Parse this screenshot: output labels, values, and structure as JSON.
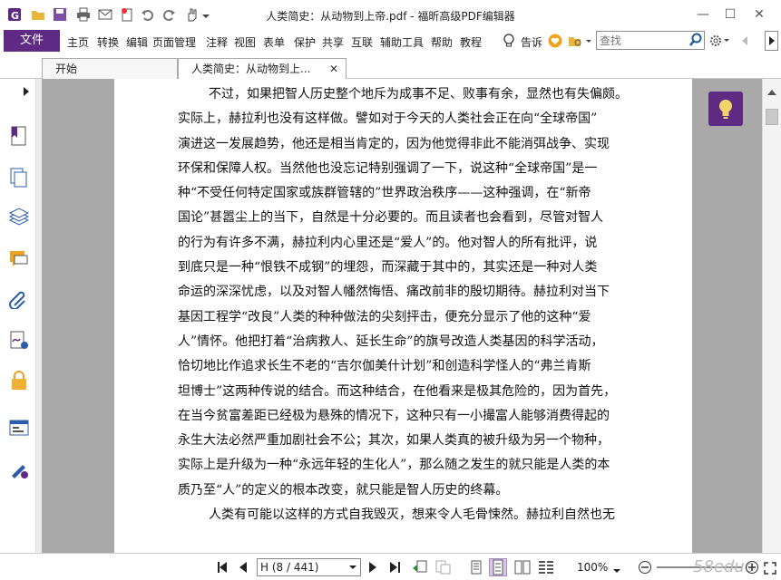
{
  "window": {
    "title": "人类简史：从动物到上帝.pdf - 福昕高级PDF编辑器",
    "minimize_glyph": "—",
    "maximize_glyph": "☐",
    "close_glyph": "✕"
  },
  "quick_access": [
    "app-logo-icon",
    "open-folder-icon",
    "save-icon",
    "print-icon",
    "email-icon",
    "new-icon",
    "undo-icon",
    "redo-icon",
    "hand-tool-icon"
  ],
  "menu": {
    "file_label": "文件",
    "items": [
      "主页",
      "转换",
      "编辑",
      "页面管理",
      "注释",
      "视图",
      "表单",
      "保护",
      "共享",
      "互联",
      "辅助工具",
      "帮助",
      "教程"
    ],
    "tell_me_label": "告诉",
    "search_placeholder": "查找"
  },
  "tabs": [
    {
      "label": "开始",
      "active": false
    },
    {
      "label": "人类简史：从动物到上...",
      "active": true
    }
  ],
  "sidebar_icons": [
    "bookmark-icon",
    "pages-icon",
    "layers-icon",
    "comments-icon",
    "attachments-icon",
    "signature-icon",
    "security-icon",
    "form-fields-icon",
    "certify-icon"
  ],
  "document": {
    "lines": [
      {
        "text": "不过，如果把智人历史整个地斥为成事不足、败事有余，显然也有失偏颇。",
        "indent": true
      },
      {
        "text": "实际上，赫拉利也没有这样做。譬如对于今天的人类社会正在向“全球帝国”",
        "indent": false
      },
      {
        "text": "演进这一发展趋势，他还是相当肯定的，因为他觉得非此不能消弭战争、实现",
        "indent": false
      },
      {
        "text": "环保和保障人权。当然他也没忘记特别强调了一下，说这种“全球帝国”是一",
        "indent": false
      },
      {
        "text": "种“不受任何特定国家或族群管辖的”世界政治秩序——这种强调，在“新帝",
        "indent": false
      },
      {
        "text": "国论”甚嚣尘上的当下，自然是十分必要的。而且读者也会看到，尽管对智人",
        "indent": false
      },
      {
        "text": "的行为有许多不满，赫拉利内心里还是“爱人”的。他对智人的所有批评，说",
        "indent": false
      },
      {
        "text": "到底只是一种“恨铁不成钢”的埋怨，而深藏于其中的，其实还是一种对人类",
        "indent": false
      },
      {
        "text": "命运的深深忧虑，以及对智人幡然悔悟、痛改前非的殷切期待。赫拉利对当下",
        "indent": false
      },
      {
        "text": "基因工程学“改良”人类的种种做法的尖刻抨击，便充分显示了他的这种“爱",
        "indent": false
      },
      {
        "text": "人”情怀。他把打着“治病救人、延长生命”的旗号改造人类基因的科学活动，",
        "indent": false
      },
      {
        "text": "恰切地比作追求长生不老的“吉尔伽美什计划”和创造科学怪人的“弗兰肯斯",
        "indent": false
      },
      {
        "text": "坦博士”这两种传说的结合。而这种结合，在他看来是极其危险的，因为首先，",
        "indent": false
      },
      {
        "text": "在当今贫富差距已经极为悬殊的情况下，这种只有一小撮富人能够消费得起的",
        "indent": false
      },
      {
        "text": "永生大法必然严重加剧社会不公；其次，如果人类真的被升级为另一个物种，",
        "indent": false
      },
      {
        "text": "实际上是升级为一种“永远年轻的生化人”，那么随之发生的就只能是人类的本",
        "indent": false
      },
      {
        "text": "质乃至“人”的定义的根本改变，就只能是智人历史的终幕。",
        "indent": false
      },
      {
        "text": "人类有可能以这样的方式自我毁灭，想来令人毛骨悚然。赫拉利自然也无",
        "indent": true
      }
    ]
  },
  "status": {
    "page_indicator": "H (8 / 441)",
    "zoom": "100%",
    "watermark": "58educ"
  },
  "colors": {
    "accent": "#5e2a84",
    "doc_background": "#a9a9a9"
  }
}
